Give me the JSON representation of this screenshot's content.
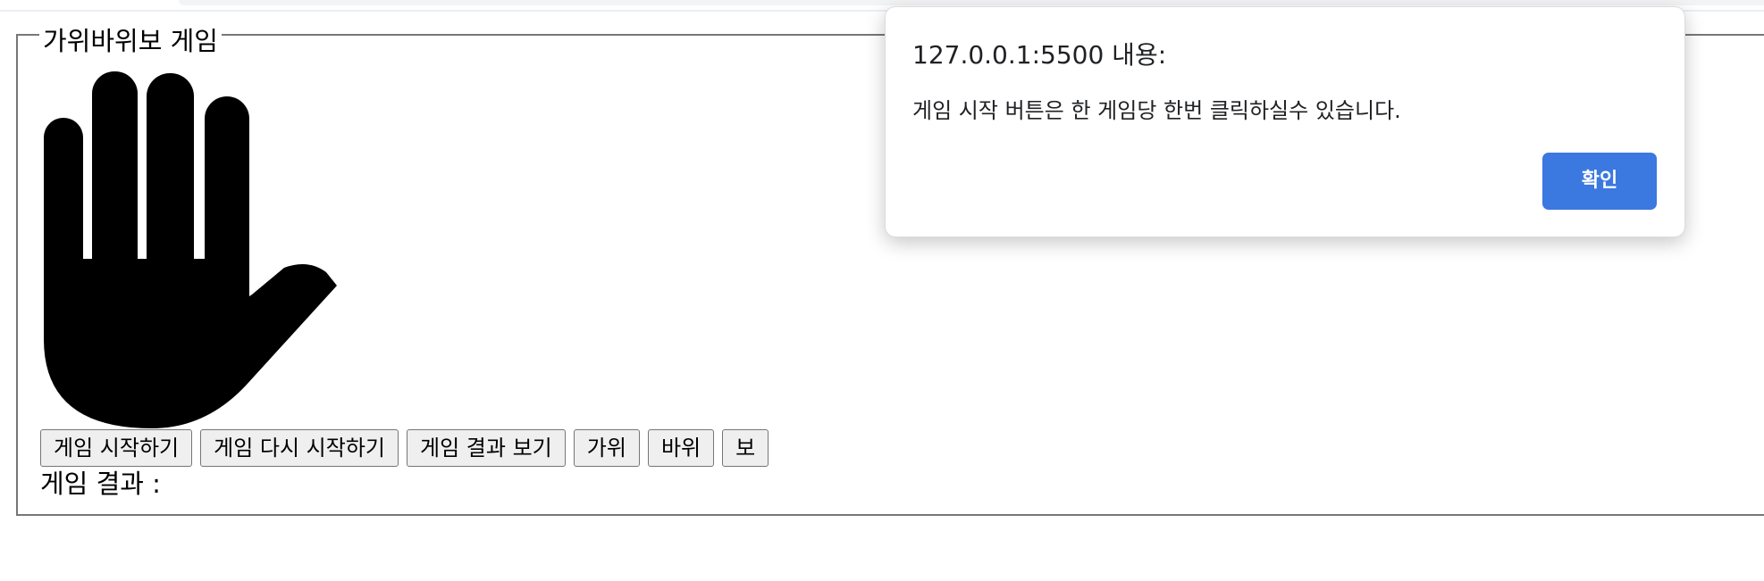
{
  "game": {
    "title": "가위바위보 게임",
    "current_hand_icon": "raised-hand-paper-icon",
    "buttons": {
      "start": "게임 시작하기",
      "restart": "게임 다시 시작하기",
      "show_result": "게임 결과 보기",
      "scissors": "가위",
      "rock": "바위",
      "paper": "보"
    },
    "result_label": "게임 결과 :",
    "result_value": ""
  },
  "alert": {
    "origin": "127.0.0.1:5500 내용:",
    "message": "게임 시작 버튼은 한 게임당 한번 클릭하실수 있습니다.",
    "ok_label": "확인",
    "accent_color": "#3b78e0"
  }
}
